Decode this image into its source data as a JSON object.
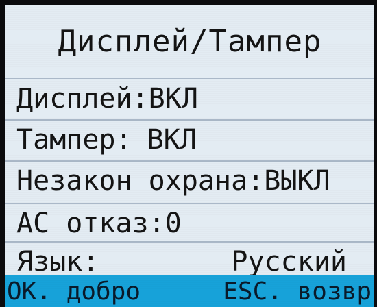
{
  "screen": {
    "title": "Дисплей/Тампер",
    "items": [
      {
        "label": "Дисплей:",
        "value": "ВКЛ"
      },
      {
        "label": "Тампер:",
        "value": "ВКЛ"
      },
      {
        "label": "Незакон охрана:",
        "value": "ВЫКЛ"
      },
      {
        "label": "AC отказ:",
        "value": "0"
      },
      {
        "label": "Язык:",
        "value": "Русский"
      }
    ]
  },
  "footer": {
    "ok_label": "OK. добро",
    "esc_label": "ESC. возвр"
  },
  "colors": {
    "screen_bg": "#e3ecf3",
    "footer_bg": "#17a2d9",
    "text": "#141414"
  }
}
